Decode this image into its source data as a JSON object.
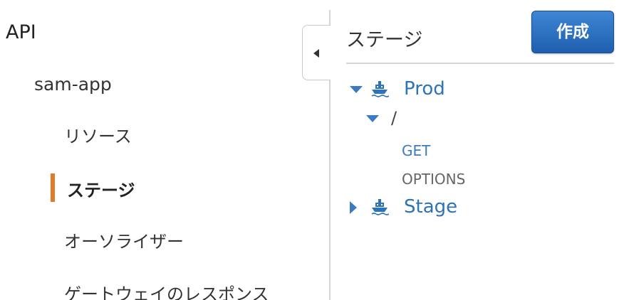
{
  "nav": {
    "api_label": "API",
    "app_label": "sam-app",
    "items": [
      {
        "label": "リソース",
        "active": false
      },
      {
        "label": "ステージ",
        "active": true
      },
      {
        "label": "オーソライザー",
        "active": false
      },
      {
        "label": "ゲートウェイのレスポンス",
        "active": false
      }
    ]
  },
  "panel": {
    "title": "ステージ",
    "create_label": "作成"
  },
  "tree": {
    "stages": [
      {
        "name": "Prod",
        "expanded": true,
        "resources": [
          {
            "path": "/",
            "expanded": true,
            "methods": [
              "GET",
              "OPTIONS"
            ]
          }
        ]
      },
      {
        "name": "Stage",
        "expanded": false
      }
    ]
  },
  "colors": {
    "accent": "#e07b2a",
    "link": "#2e73b8",
    "button": "#1e5fae"
  },
  "icons": {
    "stage": "ship-icon",
    "collapse": "caret-left-icon"
  }
}
